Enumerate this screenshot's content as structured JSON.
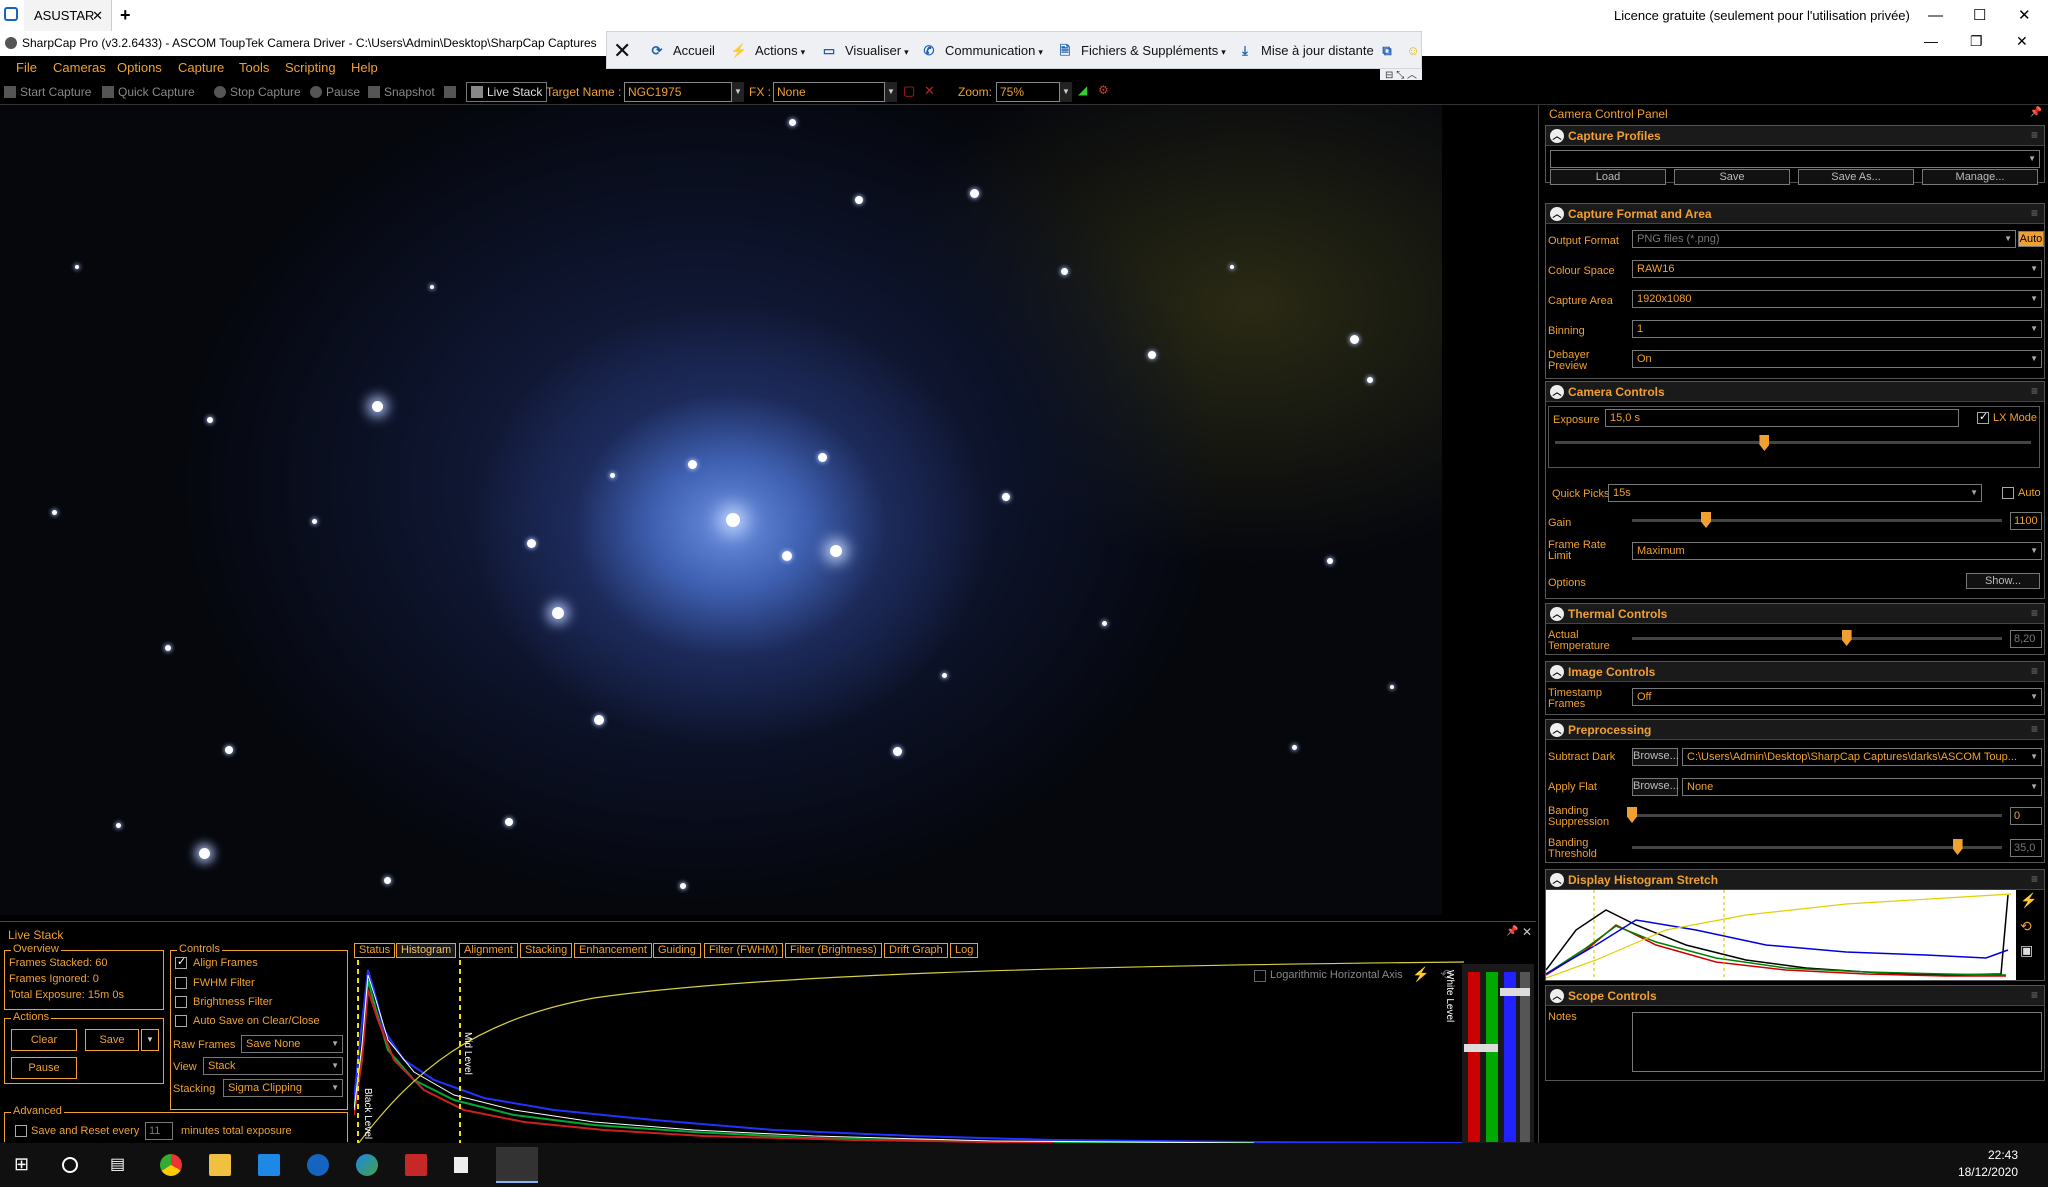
{
  "teamviewer": {
    "tab_label": "ASUSTAR",
    "tab_close": "✕",
    "new_tab": "+",
    "license": "Licence gratuite (seulement pour l'utilisation privée)",
    "min": "—",
    "max": "☐",
    "close": "✕"
  },
  "app": {
    "title": "SharpCap Pro (v3.2.6433) - ASCOM ToupTek Camera Driver - C:\\Users\\Admin\\Desktop\\SharpCap Captures",
    "min": "—",
    "max": "❐",
    "close": "✕"
  },
  "remote": {
    "close": "✕",
    "home": "Accueil",
    "actions": "Actions",
    "view": "Visualiser",
    "communication": "Communication",
    "files": "Fichiers & Suppléments",
    "update": "Mise à jour distante",
    "caret": "▾",
    "tabs": "⊟ ⤡ ︿"
  },
  "menu": [
    "File",
    "Cameras",
    "Options",
    "Capture",
    "Tools",
    "Scripting",
    "Help"
  ],
  "toolbar": {
    "start_capture": "Start Capture",
    "quick_capture": "Quick Capture",
    "stop_capture": "Stop Capture",
    "pause": "Pause",
    "snapshot": "Snapshot",
    "live_stack": "Live Stack",
    "target_label": "Target Name :",
    "target_value": "NGC1975",
    "fx_label": "FX :",
    "fx_value": "None",
    "zoom_label": "Zoom:",
    "zoom_value": "75%"
  },
  "panel": {
    "title": "Camera Control Panel",
    "pin": "📌",
    "capture_profiles": {
      "title": "Capture Profiles",
      "profile_value": "",
      "load": "Load",
      "save": "Save",
      "save_as": "Save As...",
      "manage": "Manage..."
    },
    "format": {
      "title": "Capture Format and Area",
      "output_format_label": "Output Format",
      "output_format": "PNG files (*.png)",
      "auto": "Auto",
      "colour_space_label": "Colour Space",
      "colour_space": "RAW16",
      "capture_area_label": "Capture Area",
      "capture_area": "1920x1080",
      "binning_label": "Binning",
      "binning": "1",
      "debayer_label": "Debayer Preview",
      "debayer": "On"
    },
    "camera": {
      "title": "Camera Controls",
      "exposure_label": "Exposure",
      "exposure": "15,0 s",
      "lx_mode": "LX Mode",
      "exposure_level": 0.44,
      "quick_picks_label": "Quick Picks",
      "quick_picks": "15s",
      "auto": "Auto",
      "gain_label": "Gain",
      "gain": "1100",
      "gain_level": 0.2,
      "frame_rate_label": "Frame Rate Limit",
      "frame_rate": "Maximum",
      "options_label": "Options",
      "show": "Show..."
    },
    "thermal": {
      "title": "Thermal Controls",
      "actual_temp_label": "Actual Temperature",
      "actual_temp": "8,20",
      "temp_level": 0.58
    },
    "image": {
      "title": "Image Controls",
      "timestamp_label": "Timestamp Frames",
      "timestamp": "Off"
    },
    "preprocessing": {
      "title": "Preprocessing",
      "subtract_dark_label": "Subtract Dark",
      "browse": "Browse...",
      "dark_path": "C:\\Users\\Admin\\Desktop\\SharpCap Captures\\darks\\ASCOM Toup...",
      "apply_flat_label": "Apply Flat",
      "flat_value": "None",
      "banding_suppression_label": "Banding Suppression",
      "banding_suppression": "0",
      "banding_suppression_level": 0.0,
      "banding_threshold_label": "Banding Threshold",
      "banding_threshold": "35,0",
      "banding_threshold_level": 0.88
    },
    "histogram": {
      "title": "Display Histogram Stretch"
    },
    "scope": {
      "title": "Scope Controls",
      "notes_label": "Notes"
    }
  },
  "live_stack": {
    "title": "Live Stack",
    "pin": "📌",
    "close": "✕",
    "overview_title": "Overview",
    "frames_stacked": "Frames Stacked: 60",
    "frames_ignored": "Frames Ignored:  0",
    "total_exposure": "Total Exposure:   15m 0s",
    "actions_title": "Actions",
    "clear": "Clear",
    "save": "Save",
    "pause": "Pause",
    "advanced_title": "Advanced",
    "save_reset": "Save and Reset every",
    "save_reset_value": "11",
    "save_reset_suffix": "minutes total exposure",
    "controls_title": "Controls",
    "align_frames": "Align Frames",
    "fwhm_filter": "FWHM Filter",
    "brightness_filter": "Brightness Filter",
    "auto_save": "Auto Save on Clear/Close",
    "raw_frames_label": "Raw Frames",
    "raw_frames": "Save None",
    "view_label": "View",
    "view": "Stack",
    "stacking_label": "Stacking",
    "stacking": "Sigma Clipping",
    "tabs": [
      "Status",
      "Histogram",
      "Alignment",
      "Stacking",
      "Enhancement",
      "Guiding",
      "Filter (FWHM)",
      "Filter (Brightness)",
      "Drift Graph",
      "Log"
    ],
    "selected_tab": "Histogram",
    "log_axis": "Logarithmic Horizontal Axis",
    "black_level": "Black Level",
    "mid_level": "Mid Level",
    "white_level": "White Level"
  },
  "taskbar": {
    "time": "22:43",
    "date": "18/12/2020"
  }
}
